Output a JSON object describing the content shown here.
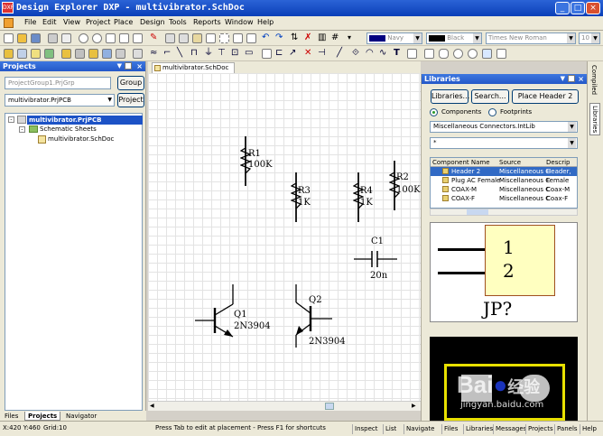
{
  "window": {
    "title": "Design Explorer DXP - multivibrator.SchDoc",
    "app_icon_text": "DXP"
  },
  "menu": [
    "File",
    "Edit",
    "View",
    "Project",
    "Place",
    "Design",
    "Tools",
    "Reports",
    "Window",
    "Help"
  ],
  "toolbar": {
    "color_combo_1": "Navy",
    "color_combo_2": "Black",
    "font_combo": "Times New Roman",
    "font_size_combo": "10"
  },
  "projects_panel": {
    "title": "Projects",
    "workspace_value": "ProjectGroup1.PrjGrp",
    "workspace_button": "Group",
    "project_value": "multivibrator.PrjPCB",
    "project_button": "Project",
    "tree": {
      "project": "multivibrator.PrjPCB",
      "folder": "Schematic Sheets",
      "document": "multivibrator.SchDoc"
    },
    "tabs": [
      "Files",
      "Projects",
      "Navigator"
    ]
  },
  "document_tab": "multivibrator.SchDoc",
  "schematic": {
    "r1_designator": "R1",
    "r1_value": "100K",
    "r2_designator": "R2",
    "r2_value": "100K",
    "r3_designator": "R3",
    "r3_value": "1K",
    "r4_designator": "R4",
    "r4_value": "1K",
    "c1_designator": "C1",
    "c1_value": "20n",
    "q1_designator": "Q1",
    "q1_value": "2N3904",
    "q2_designator": "Q2",
    "q2_value": "2N3904"
  },
  "libraries_panel": {
    "title": "Libraries",
    "libraries_button": "Libraries...",
    "search_button": "Search...",
    "place_button": "Place Header 2",
    "radio_components": "Components",
    "radio_footprints": "Footprints",
    "library_value": "Miscellaneous Connectors.IntLib",
    "filter_value": "*",
    "columns": [
      "Component Name",
      "Source",
      "Descrip"
    ],
    "rows": [
      {
        "name": "Header 2",
        "source": "Miscellaneous C",
        "desc": "Header,"
      },
      {
        "name": "Plug AC Female",
        "source": "Miscellaneous C",
        "desc": "Female"
      },
      {
        "name": "COAX-M",
        "source": "Miscellaneous C",
        "desc": "Coax-M"
      },
      {
        "name": "COAX-F",
        "source": "Miscellaneous C",
        "desc": "Coax-F"
      }
    ],
    "preview_pin1": "1",
    "preview_pin2": "2",
    "preview_designator": "JP?",
    "side_tabs": [
      "Compiled",
      "Libraries"
    ]
  },
  "watermark": {
    "brand": "Bai",
    "brand_suffix": "经验",
    "url": "jingyan.baidu.com"
  },
  "status": {
    "coords": "X:420 Y:460",
    "grid": "Grid:10",
    "message": "Press Tab to edit at placement - Press F1 for shortcuts",
    "right_tabs": [
      "Inspect",
      "List",
      "Navigate",
      "Files",
      "Libraries",
      "Messages",
      "Projects",
      "Panels",
      "Help"
    ]
  }
}
